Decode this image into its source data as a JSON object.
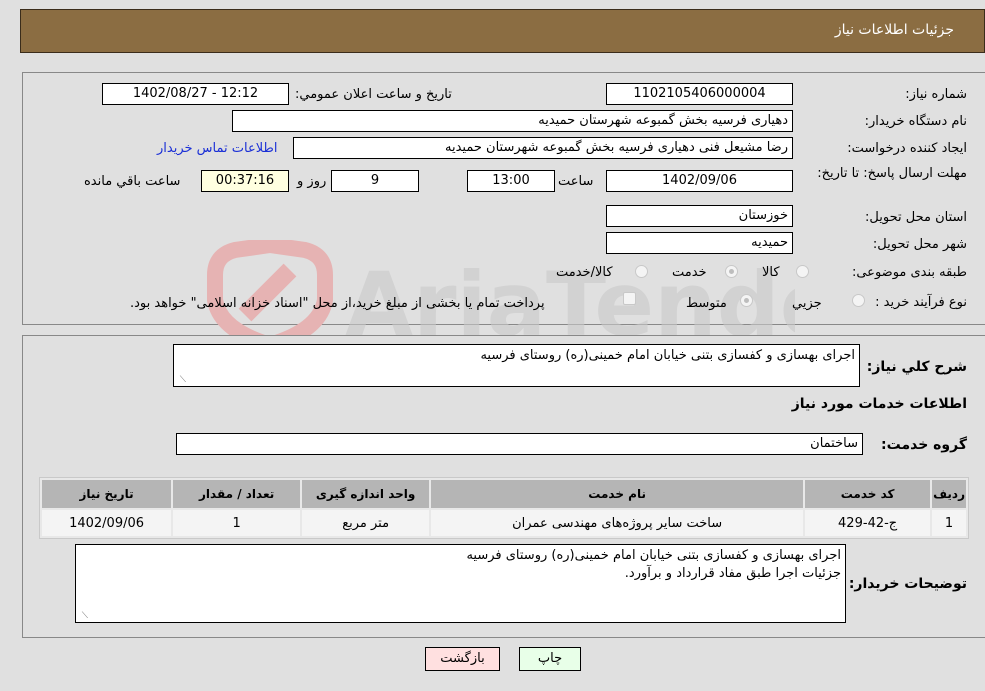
{
  "header": {
    "title": "جزئیات اطلاعات نیاز"
  },
  "form": {
    "need_number": {
      "label": "شماره نیاز:",
      "value": "1102105406000004"
    },
    "announce_datetime": {
      "label": "تاریخ و ساعت اعلان عمومي:",
      "value": "1402/08/27 - 12:12"
    },
    "buyer_org": {
      "label": "نام دستگاه خریدار:",
      "value": "دهیاری فرسیه بخش گمبوعه شهرستان حمیدیه"
    },
    "requester": {
      "label": "ایجاد کننده درخواست:",
      "value": "رضا مشیعل فنی دهیاری فرسیه بخش گمبوعه شهرستان حمیدیه",
      "contact_link": "اطلاعات تماس خریدار"
    },
    "deadline": {
      "label": "مهلت ارسال پاسخ: تا تاریخ:",
      "date": "1402/09/06",
      "time_label": "ساعت",
      "time": "13:00",
      "days": "9",
      "days_label": "روز و",
      "remaining": "00:37:16",
      "remaining_label": "ساعت باقي مانده"
    },
    "province": {
      "label": "استان محل تحویل:",
      "value": "خوزستان"
    },
    "city": {
      "label": "شهر محل تحویل:",
      "value": "حمیدیه"
    },
    "category": {
      "label": "طبقه بندی موضوعی:",
      "options": [
        {
          "label": "کالا",
          "checked": false
        },
        {
          "label": "خدمت",
          "checked": true
        },
        {
          "label": "کالا/خدمت",
          "checked": false
        }
      ]
    },
    "purchase_type": {
      "label": "نوع فرآیند خرید :",
      "options": [
        {
          "label": "جزيي",
          "checked": false
        },
        {
          "label": "متوسط",
          "checked": true
        }
      ],
      "treasury_note": "پرداخت تمام یا بخشی از مبلغ خرید،از محل \"اسناد خزانه اسلامی\" خواهد بود."
    }
  },
  "details": {
    "description_label": "شرح کلي نياز:",
    "description": "اجرای بهسازی و کفسازی بتنی خیابان امام خمینی(ره) روستای فرسیه",
    "services_heading": "اطلاعات خدمات مورد نیاز",
    "service_group_label": "گروه خدمت:",
    "service_group": "ساختمان",
    "table": {
      "headers": [
        "ردیف",
        "کد خدمت",
        "نام خدمت",
        "واحد اندازه گیری",
        "تعداد / مقدار",
        "تاریخ نیاز"
      ],
      "rows": [
        [
          "1",
          "ج-42-429",
          "ساخت سایر پروژه‌های مهندسی عمران",
          "متر مربع",
          "1",
          "1402/09/06"
        ]
      ]
    },
    "buyer_notes_label": "توضیحات خریدار:",
    "buyer_notes_line1": "اجرای بهسازی و کفسازی بتنی خیابان امام خمینی(ره) روستای فرسیه",
    "buyer_notes_line2": "جزئیات اجرا طبق مفاد قرارداد و برآورد."
  },
  "buttons": {
    "print": "چاپ",
    "back": "بازگشت"
  },
  "watermark": {
    "text": "AriaTender.net"
  }
}
